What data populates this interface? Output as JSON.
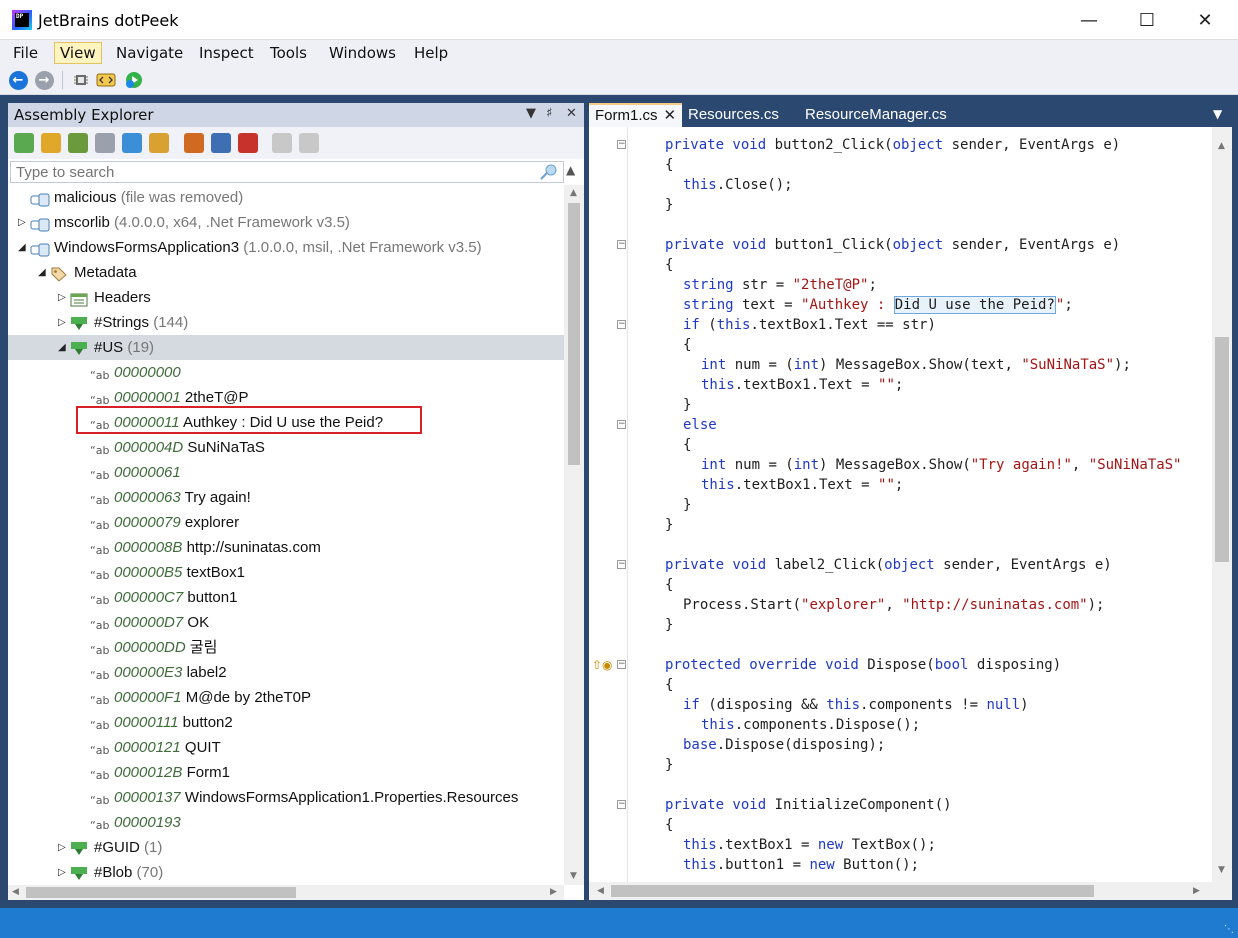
{
  "window": {
    "title": "JetBrains dotPeek",
    "logo_text": "DP",
    "controls": {
      "minimize": "—",
      "maximize": "☐",
      "close": "✕"
    }
  },
  "menu": [
    "File",
    "View",
    "Navigate",
    "Inspect",
    "Tools",
    "Windows",
    "Help"
  ],
  "menu_active": "View",
  "explorer": {
    "title": "Assembly Explorer",
    "search_placeholder": "Type to search",
    "tree": [
      {
        "indent": 0,
        "twisty": "",
        "icon": "assembly-icon",
        "name": "malicious",
        "dim": " (file was removed)"
      },
      {
        "indent": 0,
        "twisty": "▷",
        "icon": "assembly-icon",
        "name": "mscorlib",
        "dim": " (4.0.0.0, x64, .Net Framework v3.5)"
      },
      {
        "indent": 0,
        "twisty": "◢",
        "icon": "assembly-icon",
        "name": "WindowsFormsApplication3",
        "dim": " (1.0.0.0, msil, .Net Framework v3.5)"
      },
      {
        "indent": 1,
        "twisty": "◢",
        "icon": "metadata-tag-icon",
        "name": "Metadata",
        "dim": ""
      },
      {
        "indent": 2,
        "twisty": "▷",
        "icon": "headers-icon",
        "name": "Headers",
        "dim": ""
      },
      {
        "indent": 2,
        "twisty": "▷",
        "icon": "heap-icon",
        "name": "#Strings",
        "dim": " (144)"
      },
      {
        "indent": 2,
        "twisty": "◢",
        "icon": "heap-icon",
        "name": "#US",
        "dim": " (19)",
        "selected": true
      },
      {
        "indent": 3,
        "icon": "string-icon",
        "offset": "00000000",
        "name": ""
      },
      {
        "indent": 3,
        "icon": "string-icon",
        "offset": "00000001",
        "name": "2theT@P"
      },
      {
        "indent": 3,
        "icon": "string-icon",
        "offset": "00000011",
        "name": "Authkey : Did U use the Peid?"
      },
      {
        "indent": 3,
        "icon": "string-icon",
        "offset": "0000004D",
        "name": "SuNiNaTaS"
      },
      {
        "indent": 3,
        "icon": "string-icon",
        "offset": "00000061",
        "name": ""
      },
      {
        "indent": 3,
        "icon": "string-icon",
        "offset": "00000063",
        "name": "Try again!"
      },
      {
        "indent": 3,
        "icon": "string-icon",
        "offset": "00000079",
        "name": "explorer"
      },
      {
        "indent": 3,
        "icon": "string-icon",
        "offset": "0000008B",
        "name": "http://suninatas.com"
      },
      {
        "indent": 3,
        "icon": "string-icon",
        "offset": "000000B5",
        "name": "textBox1"
      },
      {
        "indent": 3,
        "icon": "string-icon",
        "offset": "000000C7",
        "name": "button1"
      },
      {
        "indent": 3,
        "icon": "string-icon",
        "offset": "000000D7",
        "name": "OK"
      },
      {
        "indent": 3,
        "icon": "string-icon",
        "offset": "000000DD",
        "name": "굴림"
      },
      {
        "indent": 3,
        "icon": "string-icon",
        "offset": "000000E3",
        "name": "label2"
      },
      {
        "indent": 3,
        "icon": "string-icon",
        "offset": "000000F1",
        "name": "M@de by 2theT0P"
      },
      {
        "indent": 3,
        "icon": "string-icon",
        "offset": "00000111",
        "name": "button2"
      },
      {
        "indent": 3,
        "icon": "string-icon",
        "offset": "00000121",
        "name": "QUIT"
      },
      {
        "indent": 3,
        "icon": "string-icon",
        "offset": "0000012B",
        "name": "Form1"
      },
      {
        "indent": 3,
        "icon": "string-icon",
        "offset": "00000137",
        "name": "WindowsFormsApplication1.Properties.Resources"
      },
      {
        "indent": 3,
        "icon": "string-icon",
        "offset": "00000193",
        "name": ""
      },
      {
        "indent": 2,
        "twisty": "▷",
        "icon": "heap-icon",
        "name": "#GUID",
        "dim": " (1)"
      },
      {
        "indent": 2,
        "twisty": "▷",
        "icon": "heap-icon",
        "name": "#Blob",
        "dim": " (70)"
      }
    ]
  },
  "editor": {
    "tabs": [
      {
        "label": "Form1.cs",
        "active": true
      },
      {
        "label": "Resources.cs",
        "active": false
      },
      {
        "label": "ResourceManager.cs",
        "active": false
      }
    ],
    "lines": [
      {
        "indent": 0,
        "fold": true,
        "segs": [
          [
            "kw",
            "private void "
          ],
          [
            "",
            "button2_Click("
          ],
          [
            "kw",
            "object"
          ],
          [
            "",
            " sender, EventArgs e)"
          ]
        ]
      },
      {
        "indent": 0,
        "segs": [
          [
            "",
            "{"
          ]
        ]
      },
      {
        "indent": 1,
        "segs": [
          [
            "kw",
            "this"
          ],
          [
            "",
            ".Close();"
          ]
        ]
      },
      {
        "indent": 0,
        "segs": [
          [
            "",
            "}"
          ]
        ]
      },
      {
        "indent": 0,
        "segs": []
      },
      {
        "indent": 0,
        "fold": true,
        "segs": [
          [
            "kw",
            "private void "
          ],
          [
            "",
            "button1_Click("
          ],
          [
            "kw",
            "object"
          ],
          [
            "",
            " sender, EventArgs e)"
          ]
        ]
      },
      {
        "indent": 0,
        "segs": [
          [
            "",
            "{"
          ]
        ]
      },
      {
        "indent": 1,
        "segs": [
          [
            "kw",
            "string"
          ],
          [
            "",
            " str = "
          ],
          [
            "st",
            "\"2theT@P\""
          ],
          [
            "",
            ";"
          ]
        ]
      },
      {
        "indent": 1,
        "segs": [
          [
            "kw",
            "string"
          ],
          [
            "",
            " text = "
          ],
          [
            "st",
            "\"Authkey : "
          ],
          [
            "hl",
            "Did U use the Peid?"
          ],
          [
            "st",
            "\""
          ],
          [
            "",
            ";"
          ]
        ]
      },
      {
        "indent": 1,
        "fold": true,
        "segs": [
          [
            "kw",
            "if"
          ],
          [
            "",
            " ("
          ],
          [
            "kw",
            "this"
          ],
          [
            "",
            ".textBox1.Text == str)"
          ]
        ]
      },
      {
        "indent": 1,
        "segs": [
          [
            "",
            "{"
          ]
        ]
      },
      {
        "indent": 2,
        "segs": [
          [
            "kw",
            "int"
          ],
          [
            "",
            " num = ("
          ],
          [
            "kw",
            "int"
          ],
          [
            "",
            ") MessageBox.Show(text, "
          ],
          [
            "st",
            "\"SuNiNaTaS\""
          ],
          [
            "",
            ");"
          ]
        ]
      },
      {
        "indent": 2,
        "segs": [
          [
            "kw",
            "this"
          ],
          [
            "",
            ".textBox1.Text = "
          ],
          [
            "st",
            "\"\""
          ],
          [
            "",
            ";"
          ]
        ]
      },
      {
        "indent": 1,
        "segs": [
          [
            "",
            "}"
          ]
        ]
      },
      {
        "indent": 1,
        "fold": true,
        "segs": [
          [
            "kw",
            "else"
          ]
        ]
      },
      {
        "indent": 1,
        "segs": [
          [
            "",
            "{"
          ]
        ]
      },
      {
        "indent": 2,
        "segs": [
          [
            "kw",
            "int"
          ],
          [
            "",
            " num = ("
          ],
          [
            "kw",
            "int"
          ],
          [
            "",
            ") MessageBox.Show("
          ],
          [
            "st",
            "\"Try again!\""
          ],
          [
            "",
            ", "
          ],
          [
            "st",
            "\"SuNiNaTaS\""
          ]
        ]
      },
      {
        "indent": 2,
        "segs": [
          [
            "kw",
            "this"
          ],
          [
            "",
            ".textBox1.Text = "
          ],
          [
            "st",
            "\"\""
          ],
          [
            "",
            ";"
          ]
        ]
      },
      {
        "indent": 1,
        "segs": [
          [
            "",
            "}"
          ]
        ]
      },
      {
        "indent": 0,
        "segs": [
          [
            "",
            "}"
          ]
        ]
      },
      {
        "indent": 0,
        "segs": []
      },
      {
        "indent": 0,
        "fold": true,
        "segs": [
          [
            "kw",
            "private void "
          ],
          [
            "",
            "label2_Click("
          ],
          [
            "kw",
            "object"
          ],
          [
            "",
            " sender, EventArgs e)"
          ]
        ]
      },
      {
        "indent": 0,
        "segs": [
          [
            "",
            "{"
          ]
        ]
      },
      {
        "indent": 1,
        "segs": [
          [
            "",
            "Process.Start("
          ],
          [
            "st",
            "\"explorer\""
          ],
          [
            "",
            ", "
          ],
          [
            "st",
            "\"http://suninatas.com\""
          ],
          [
            "",
            ");"
          ]
        ]
      },
      {
        "indent": 0,
        "segs": [
          [
            "",
            "}"
          ]
        ]
      },
      {
        "indent": 0,
        "segs": []
      },
      {
        "indent": 0,
        "fold": true,
        "override": true,
        "segs": [
          [
            "kw",
            "protected override void "
          ],
          [
            "",
            "Dispose("
          ],
          [
            "kw",
            "bool"
          ],
          [
            "",
            " disposing)"
          ]
        ]
      },
      {
        "indent": 0,
        "segs": [
          [
            "",
            "{"
          ]
        ]
      },
      {
        "indent": 1,
        "segs": [
          [
            "kw",
            "if"
          ],
          [
            "",
            " (disposing && "
          ],
          [
            "kw",
            "this"
          ],
          [
            "",
            ".components != "
          ],
          [
            "kw",
            "null"
          ],
          [
            "",
            ")"
          ]
        ]
      },
      {
        "indent": 2,
        "segs": [
          [
            "kw",
            "this"
          ],
          [
            "",
            ".components.Dispose();"
          ]
        ]
      },
      {
        "indent": 1,
        "segs": [
          [
            "kw",
            "base"
          ],
          [
            "",
            ".Dispose(disposing);"
          ]
        ]
      },
      {
        "indent": 0,
        "segs": [
          [
            "",
            "}"
          ]
        ]
      },
      {
        "indent": 0,
        "segs": []
      },
      {
        "indent": 0,
        "fold": true,
        "segs": [
          [
            "kw",
            "private void "
          ],
          [
            "",
            "InitializeComponent()"
          ]
        ]
      },
      {
        "indent": 0,
        "segs": [
          [
            "",
            "{"
          ]
        ]
      },
      {
        "indent": 1,
        "segs": [
          [
            "kw",
            "this"
          ],
          [
            "",
            ".textBox1 = "
          ],
          [
            "kw",
            "new"
          ],
          [
            "",
            " TextBox();"
          ]
        ]
      },
      {
        "indent": 1,
        "segs": [
          [
            "kw",
            "this"
          ],
          [
            "",
            ".button1 = "
          ],
          [
            "kw",
            "new"
          ],
          [
            "",
            " Button();"
          ]
        ]
      }
    ]
  },
  "colors": {
    "workspace": "#2b4870",
    "statusbar": "#1f7bd0",
    "keyword": "#1f39c4",
    "string": "#a31515",
    "highlight_box": "#d72027"
  }
}
